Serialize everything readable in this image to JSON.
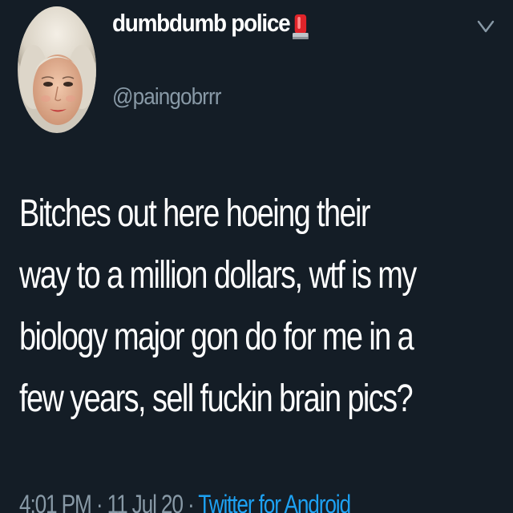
{
  "tweet": {
    "author": {
      "display_name": "dumbdumb police",
      "handle": "@paingobrrr",
      "avatar_icon": "woman-portrait-avatar",
      "name_emoji_icon": "rotating-light-icon"
    },
    "text_lines": [
      "Bitches out here hoeing their",
      "way to a million dollars, wtf is my",
      "biology major gon do for me in a",
      "few years, sell fuckin brain pics?"
    ],
    "meta": {
      "time": "4:01 PM",
      "separator": "·",
      "date": "11 Jul 20",
      "source": "Twitter for Android"
    }
  },
  "colors": {
    "background": "#141d26",
    "primary_text": "#ffffff",
    "secondary_text": "#8899a6",
    "link": "#1da1f2"
  }
}
